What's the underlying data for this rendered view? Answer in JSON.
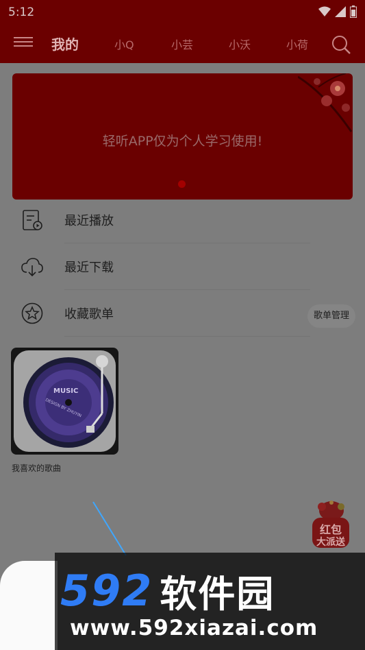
{
  "status_bar": {
    "time": "5:12"
  },
  "app_bar": {
    "tabs": [
      {
        "label": "我的"
      },
      {
        "label": "小Q"
      },
      {
        "label": "小芸"
      },
      {
        "label": "小沃"
      },
      {
        "label": "小荷"
      }
    ]
  },
  "banner": {
    "text": "轻听APP仅为个人学习使用!"
  },
  "menu": {
    "items": [
      {
        "label": "最近播放",
        "icon": "recent-play-icon"
      },
      {
        "label": "最近下载",
        "icon": "cloud-download-icon"
      },
      {
        "label": "收藏歌单",
        "icon": "star-icon"
      }
    ],
    "manage_label": "歌单管理"
  },
  "playlist": {
    "cover_title": "MUSIC",
    "cover_subtitle": "DESIGN BY ZHUYIN",
    "caption": "我喜欢的歌曲"
  },
  "redpacket": {
    "line1": "红包",
    "line2": "大派送"
  },
  "watermark": {
    "brand_num": "592",
    "brand_cn": "软件园",
    "url": "www.592xiazai.com"
  },
  "colors": {
    "appbar": "#6b0000",
    "overlay": "#7d7d7d",
    "watermark_blue": "#2f7cf5"
  }
}
